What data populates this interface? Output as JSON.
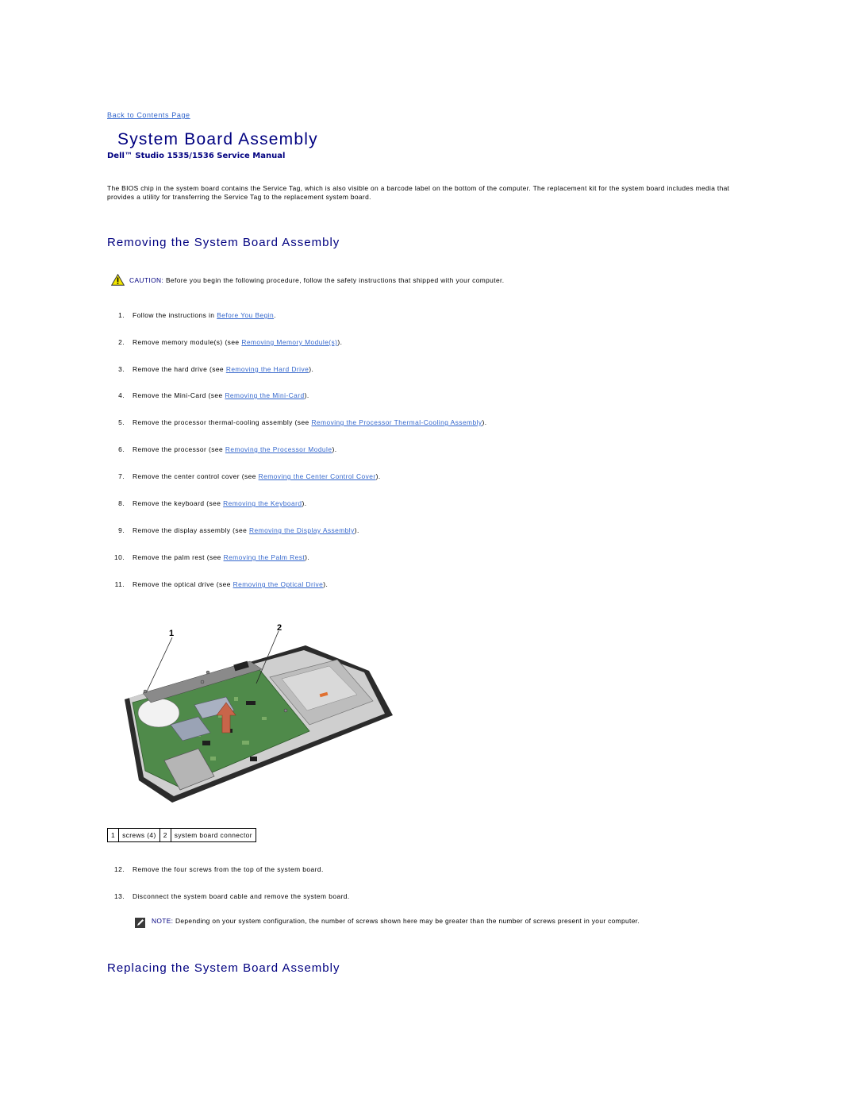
{
  "nav": {
    "back_link": "Back to Contents Page"
  },
  "header": {
    "title": "System Board Assembly",
    "manual": "Dell™ Studio 1535/1536 Service Manual"
  },
  "intro": "The BIOS chip in the system board contains the Service Tag, which is also visible on a barcode label on the bottom of the computer. The replacement kit for the system board includes media that provides a utility for transferring the Service Tag to the replacement system board.",
  "removing": {
    "heading": "Removing the System Board Assembly",
    "caution": {
      "icon": "warning-triangle-icon",
      "label": "CAUTION:",
      "text": " Before you begin the following procedure, follow the safety instructions that shipped with your computer."
    },
    "steps": [
      {
        "num": "1.",
        "pre": "Follow the instructions in ",
        "link": "Before You Begin",
        "post": "."
      },
      {
        "num": "2.",
        "pre": "Remove memory module(s) (see ",
        "link": "Removing Memory Module(s)",
        "post": ")."
      },
      {
        "num": "3.",
        "pre": "Remove the hard drive (see ",
        "link": "Removing the Hard Drive",
        "post": ")."
      },
      {
        "num": "4.",
        "pre": "Remove the Mini-Card (see ",
        "link": "Removing the Mini-Card",
        "post": ")."
      },
      {
        "num": "5.",
        "pre": "Remove the processor thermal-cooling assembly (see ",
        "link": "Removing the Processor Thermal-Cooling Assembly",
        "post": ")."
      },
      {
        "num": "6.",
        "pre": "Remove the processor (see ",
        "link": "Removing the Processor Module",
        "post": ")."
      },
      {
        "num": "7.",
        "pre": "Remove the center control cover (see ",
        "link": "Removing the Center Control Cover",
        "post": ")."
      },
      {
        "num": "8.",
        "pre": "Remove the keyboard (see ",
        "link": "Removing the Keyboard",
        "post": ")."
      },
      {
        "num": "9.",
        "pre": "Remove the display assembly (see ",
        "link": "Removing the Display Assembly",
        "post": ")."
      },
      {
        "num": "10.",
        "pre": "Remove the palm rest (see ",
        "link": "Removing the Palm Rest",
        "post": ")."
      },
      {
        "num": "11.",
        "pre": "Remove the optical drive (see ",
        "link": "Removing the Optical Drive",
        "post": ")."
      }
    ],
    "figure": {
      "callouts": [
        "1",
        "2"
      ]
    },
    "legend": [
      {
        "num": "1",
        "label": "screws (4)"
      },
      {
        "num": "2",
        "label": "system board connector"
      }
    ],
    "steps_after": [
      {
        "num": "12.",
        "text": "Remove the four screws from the top of the system board."
      },
      {
        "num": "13.",
        "text": "Disconnect the system board cable and remove the system board."
      }
    ],
    "note": {
      "icon": "note-pencil-icon",
      "label": "NOTE:",
      "text": " Depending on your system configuration, the number of screws shown here may be greater than the number of screws present in your computer."
    }
  },
  "replacing": {
    "heading": "Replacing the System Board Assembly"
  },
  "colors": {
    "heading": "#000080",
    "link": "#3366cc"
  }
}
